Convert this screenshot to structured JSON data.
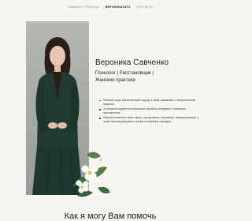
{
  "nav": {
    "items": [
      {
        "label": "ГЛАВНАЯ СТРАНИЦА",
        "active": false
      },
      {
        "label": "ВЕРОНИКАТАТО",
        "active": true
      },
      {
        "label": "КОНТАКТЫ",
        "active": false
      }
    ]
  },
  "hero": {
    "name": "Вероника Савченко",
    "roles": [
      "Психолог | Расстановщик |",
      "Женские практики"
    ],
    "bullets": [
      "Работаю через аналитический подход, а также шаманские и энергетические практики.",
      "Сочетаю инструменты психологии, коучинга, эзотерики и глубинного психоанализа.",
      "Помогаю изменить такие сферы, как финансы, отношения, самореализация, а также трансформировать личные и семейные сценарии."
    ]
  },
  "section": {
    "title": "Как я могу Вам помочь"
  }
}
